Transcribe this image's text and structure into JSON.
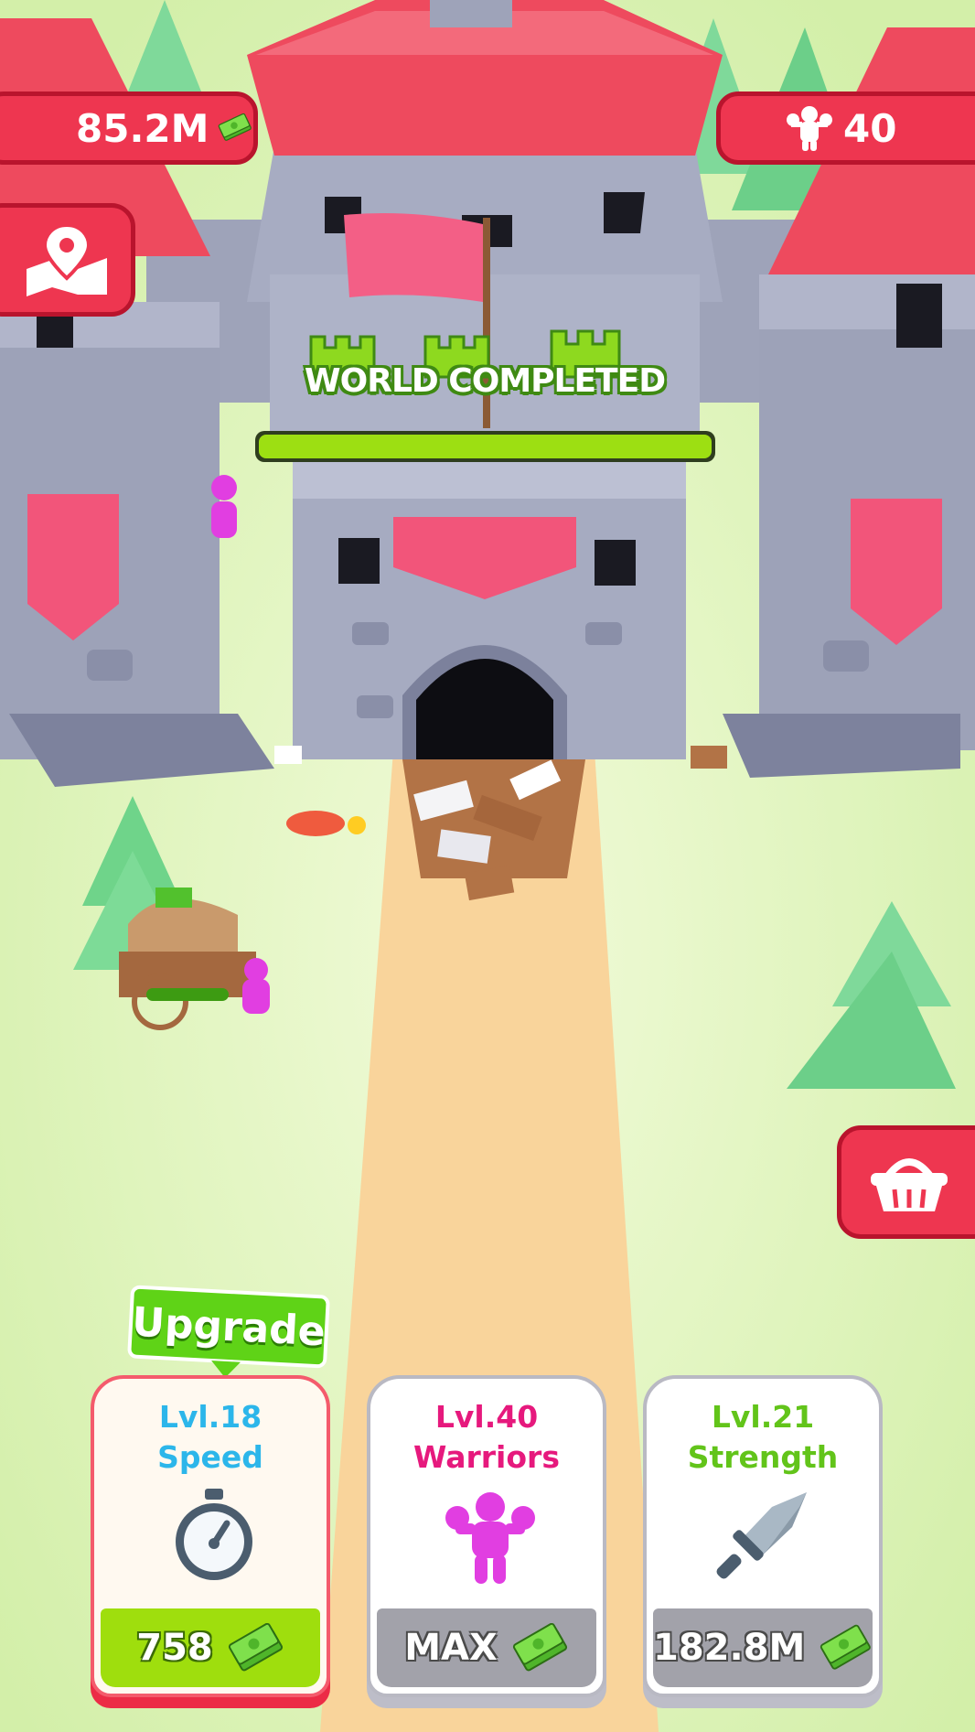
{
  "hud": {
    "money": "85.2M",
    "money_icon": "cash-stack-icon",
    "warriors": "40",
    "warriors_icon": "warrior-icon"
  },
  "side_buttons": {
    "map_icon": "map-pin-icon",
    "shop_icon": "shopping-basket-icon"
  },
  "world": {
    "title": "WORLD COMPLETED",
    "progress": 1.0
  },
  "upgrade_tag": "Upgrade",
  "cards": [
    {
      "level": "Lvl.18",
      "name": "Speed",
      "price": "758",
      "icon": "stopwatch-icon",
      "color": "#2cb6ea",
      "active": true
    },
    {
      "level": "Lvl.40",
      "name": "Warriors",
      "price": "MAX",
      "icon": "warrior-icon",
      "color": "#e6197d",
      "active": false
    },
    {
      "level": "Lvl.21",
      "name": "Strength",
      "price": "182.8M",
      "icon": "sword-icon",
      "color": "#62c41a",
      "active": false
    }
  ],
  "colors": {
    "accent_red": "#ee3650",
    "accent_green": "#9fde0d",
    "grass": "#e4f6c7",
    "path": "#f9d49b"
  }
}
